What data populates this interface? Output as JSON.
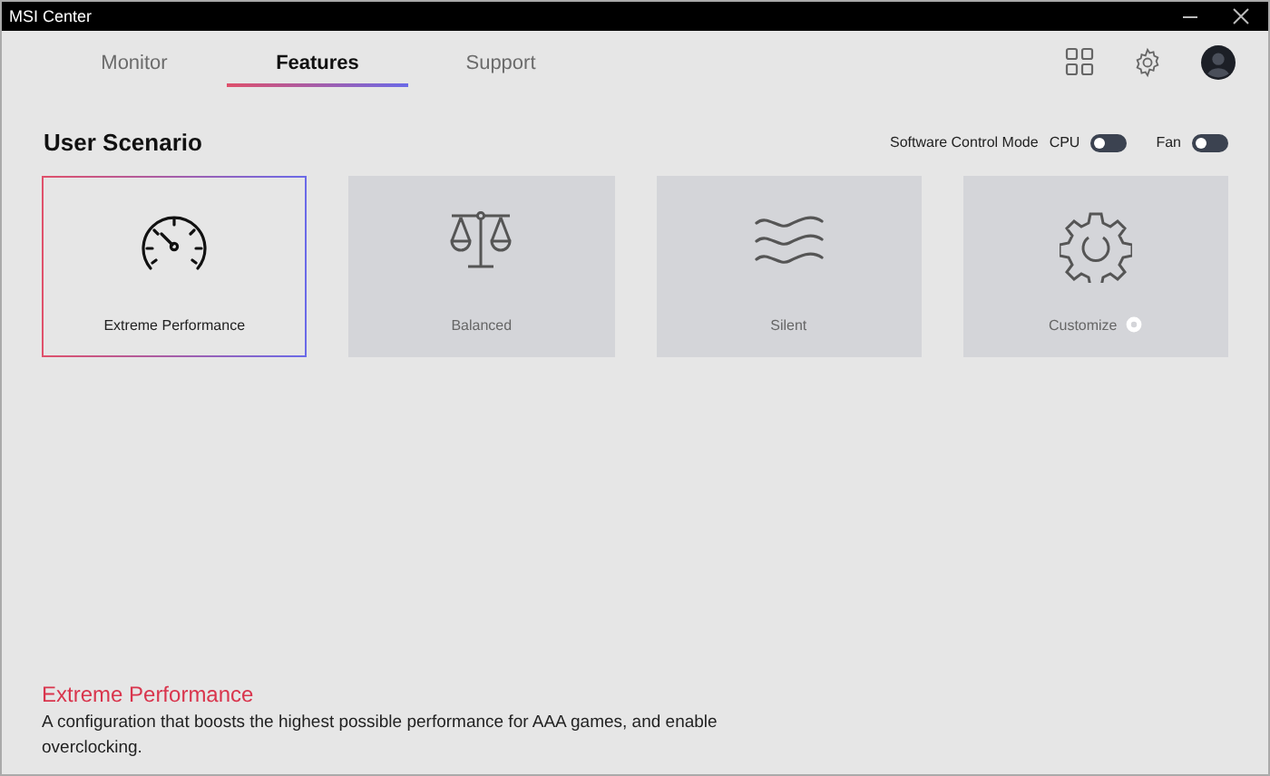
{
  "window": {
    "title": "MSI Center"
  },
  "tabs": [
    {
      "label": "Monitor",
      "selected": false
    },
    {
      "label": "Features",
      "selected": true
    },
    {
      "label": "Support",
      "selected": false
    }
  ],
  "section": {
    "title": "User Scenario"
  },
  "control_mode": {
    "label": "Software Control Mode",
    "toggles": [
      {
        "label": "CPU",
        "on": false
      },
      {
        "label": "Fan",
        "on": false
      }
    ]
  },
  "scenarios": [
    {
      "kind": "gauge",
      "label": "Extreme Performance",
      "selected": true
    },
    {
      "kind": "scale",
      "label": "Balanced",
      "selected": false
    },
    {
      "kind": "waves",
      "label": "Silent",
      "selected": false
    },
    {
      "kind": "gear",
      "label": "Customize",
      "selected": false,
      "settings": true
    }
  ],
  "description": {
    "title": "Extreme Performance",
    "text": "A configuration that boosts the highest possible performance for AAA games, and enable overclocking."
  }
}
